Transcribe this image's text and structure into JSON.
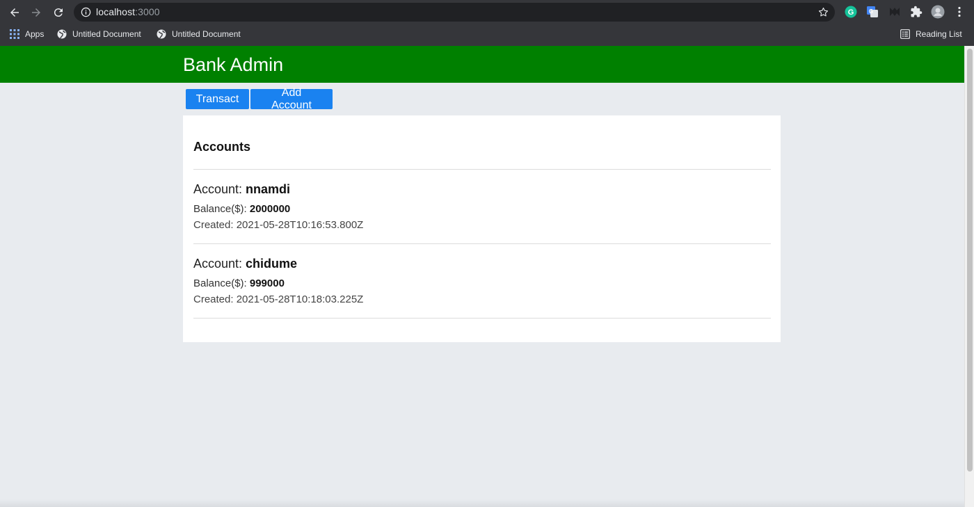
{
  "browser": {
    "url_host": "localhost",
    "url_port": ":3000",
    "bookmarks": [
      {
        "label": "Apps",
        "icon": "apps-grid-icon"
      },
      {
        "label": "Untitled Document",
        "icon": "globe-icon"
      },
      {
        "label": "Untitled Document",
        "icon": "globe-icon"
      }
    ],
    "reading_list": "Reading List"
  },
  "app": {
    "title": "Bank Admin",
    "brand_color": "#008000",
    "button_color": "#1a82f0"
  },
  "actions": {
    "transact": "Transact",
    "add_account": "Add Account"
  },
  "accounts": {
    "heading": "Accounts",
    "account_label": "Account:",
    "balance_label": "Balance($):",
    "created_label": "Created:",
    "items": [
      {
        "name": "nnamdi",
        "balance": "2000000",
        "created": "2021-05-28T10:16:53.800Z"
      },
      {
        "name": "chidume",
        "balance": "999000",
        "created": "2021-05-28T10:18:03.225Z"
      }
    ]
  }
}
